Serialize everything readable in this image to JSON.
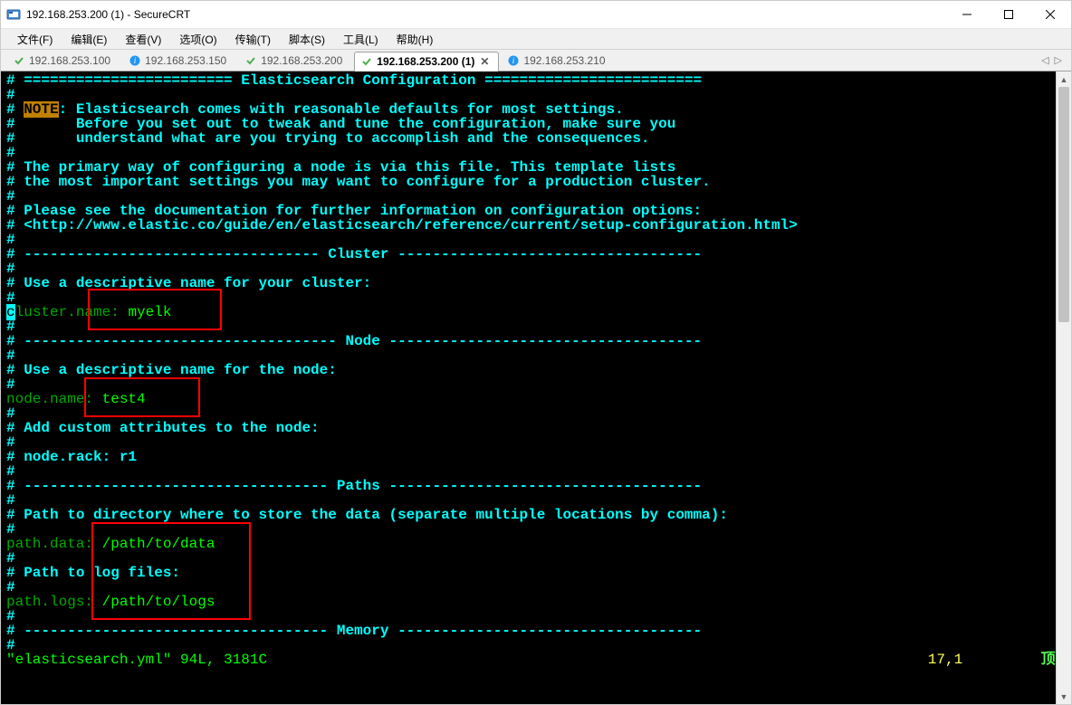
{
  "window": {
    "title": "192.168.253.200 (1) - SecureCRT"
  },
  "menu": {
    "file": "文件(F)",
    "edit": "编辑(E)",
    "view": "查看(V)",
    "options": "选项(O)",
    "transfer": "传输(T)",
    "script": "脚本(S)",
    "tools": "工具(L)",
    "help": "帮助(H)"
  },
  "tabs": [
    {
      "label": "192.168.253.100",
      "icon": "check"
    },
    {
      "label": "192.168.253.150",
      "icon": "info"
    },
    {
      "label": "192.168.253.200",
      "icon": "check"
    },
    {
      "label": "192.168.253.200 (1)",
      "icon": "check",
      "active": true
    },
    {
      "label": "192.168.253.210",
      "icon": "info"
    }
  ],
  "terminal": {
    "header_title": "Elasticsearch Configuration",
    "note_label": "NOTE",
    "intro1": ": Elasticsearch comes with reasonable defaults for most settings.",
    "intro2": "Before you set out to tweak and tune the configuration, make sure you",
    "intro3": "understand what are you trying to accomplish and the consequences.",
    "para1a": "The primary way of configuring a node is via this file. This template lists",
    "para1b": "the most important settings you may want to configure for a production cluster.",
    "para2a": "Please see the documentation for further information on configuration options:",
    "para2b": "<http://www.elastic.co/guide/en/elasticsearch/reference/current/setup-configuration.html>",
    "section_cluster": "Cluster",
    "cluster_desc": "Use a descriptive name for your cluster:",
    "cluster_name_key": "cluster.name",
    "cluster_name_val": "myelk",
    "section_node": "Node",
    "node_desc": "Use a descriptive name for the node:",
    "node_name_key": "node.name",
    "node_name_val": "test4",
    "node_attr": "Add custom attributes to the node:",
    "node_rack": "node.rack: r1",
    "section_paths": "Paths",
    "paths_desc": "Path to directory where to store the data (separate multiple locations by comma):",
    "path_data_key": "path.data",
    "path_data_val": "/path/to/data",
    "path_logs_desc": "Path to log files:",
    "path_logs_key": "path.logs",
    "path_logs_val": "/path/to/logs",
    "section_memory": "Memory",
    "status_file": "\"elasticsearch.yml\" 94L, 3181C",
    "status_pos": "17,1",
    "status_word": "顶端"
  }
}
